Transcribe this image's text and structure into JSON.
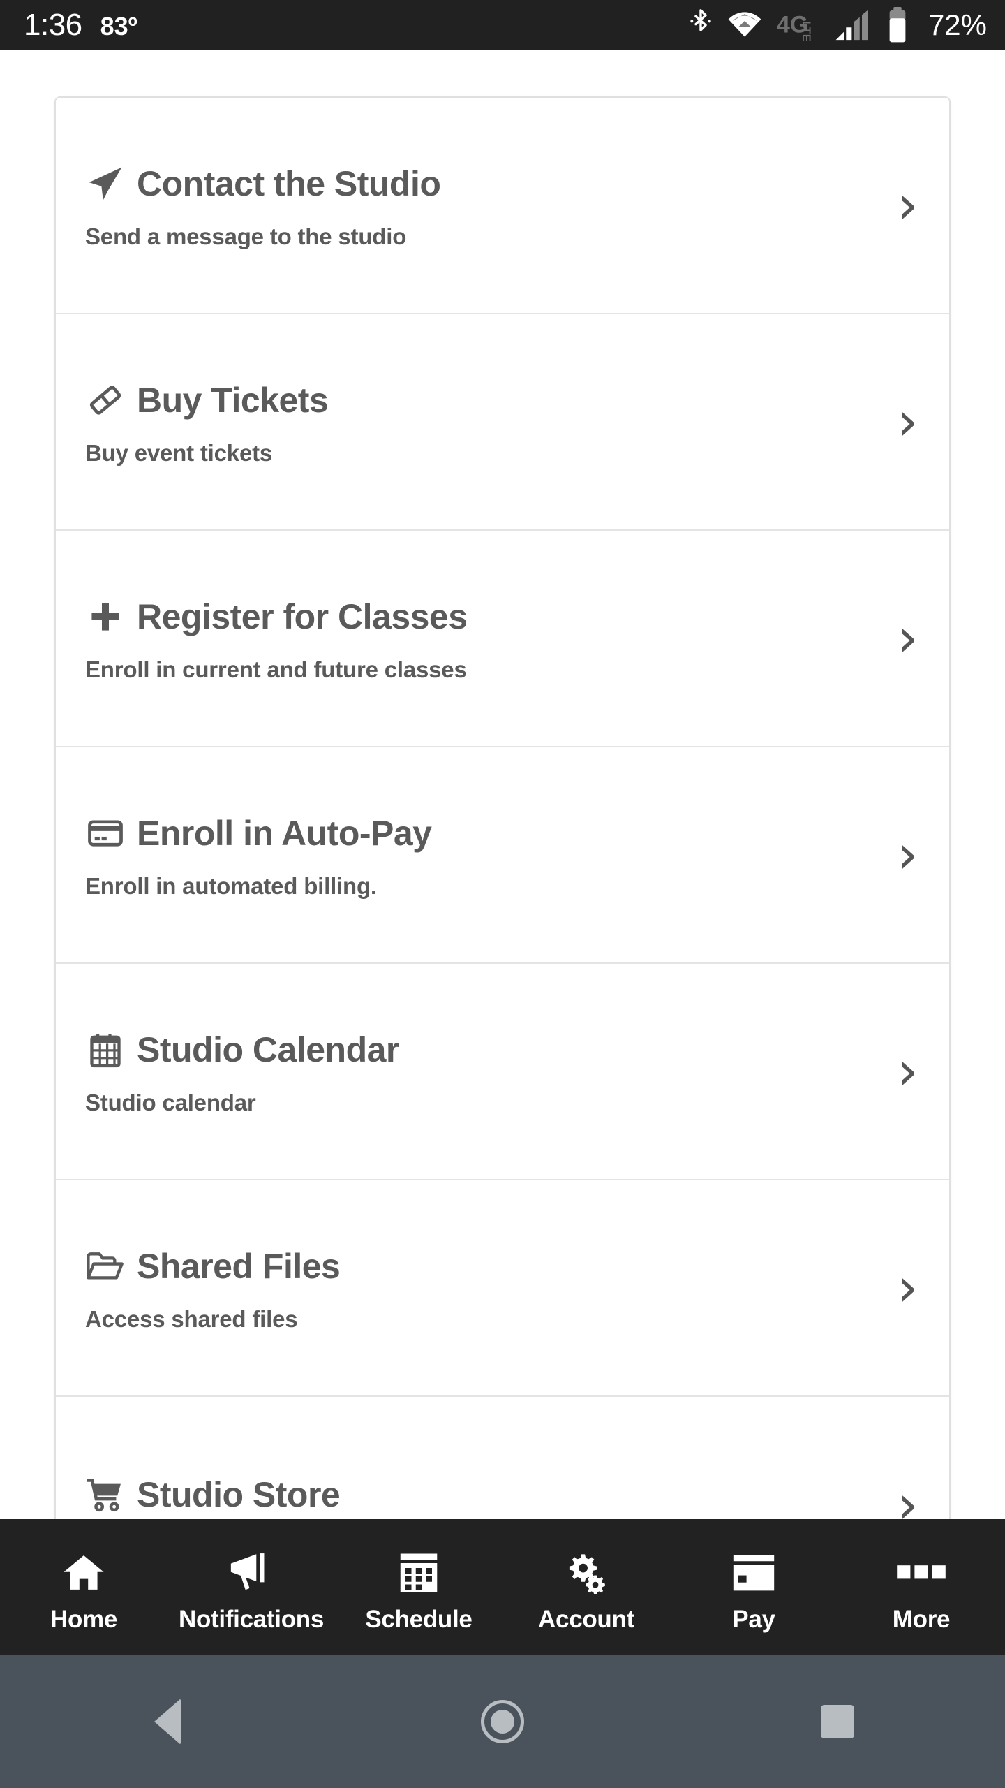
{
  "status_bar": {
    "clock": "1:36",
    "temperature": "83º",
    "battery_percent": "72%",
    "icons": [
      "bluetooth-icon",
      "wifi-icon",
      "4glte-icon",
      "cellular-signal-icon",
      "battery-icon"
    ],
    "network_label": "4G",
    "network_sublabel": "LTE",
    "background_color": "#212121",
    "text_color": "#ffffff"
  },
  "menu": {
    "items": [
      {
        "title": "Contact the Studio",
        "subtitle": "Send a message to the studio",
        "icon": "paper-plane-icon",
        "chevron": "›"
      },
      {
        "title": "Buy Tickets",
        "subtitle": "Buy event tickets",
        "icon": "ticket-icon",
        "chevron": "›"
      },
      {
        "title": "Register for Classes",
        "subtitle": "Enroll in current and future classes",
        "icon": "plus-icon",
        "chevron": "›"
      },
      {
        "title": "Enroll in Auto-Pay",
        "subtitle": "Enroll in automated billing.",
        "icon": "credit-card-icon",
        "chevron": "›"
      },
      {
        "title": "Studio Calendar",
        "subtitle": "Studio calendar",
        "icon": "calendar-icon",
        "chevron": "›"
      },
      {
        "title": "Shared Files",
        "subtitle": "Access shared files",
        "icon": "open-folder-icon",
        "chevron": "›"
      },
      {
        "title": "Studio Store",
        "subtitle": "",
        "icon": "shopping-cart-icon",
        "chevron": "›"
      }
    ],
    "text_color": "#5a5a5a",
    "divider_color": "#e4e4e4"
  },
  "tab_bar": {
    "background_color": "#222222",
    "tabs": [
      {
        "label": "Home",
        "icon": "house-icon"
      },
      {
        "label": "Notifications",
        "icon": "megaphone-icon"
      },
      {
        "label": "Schedule",
        "icon": "calendar-grid-icon"
      },
      {
        "label": "Account",
        "icon": "gears-icon"
      },
      {
        "label": "Pay",
        "icon": "credit-card-icon"
      },
      {
        "label": "More",
        "icon": "three-squares-icon"
      }
    ]
  },
  "android_nav": {
    "background_color": "#4a535b",
    "buttons": [
      {
        "name": "back",
        "icon": "back-triangle-icon"
      },
      {
        "name": "home",
        "icon": "home-circle-icon"
      },
      {
        "name": "recents",
        "icon": "recents-square-icon"
      }
    ]
  }
}
